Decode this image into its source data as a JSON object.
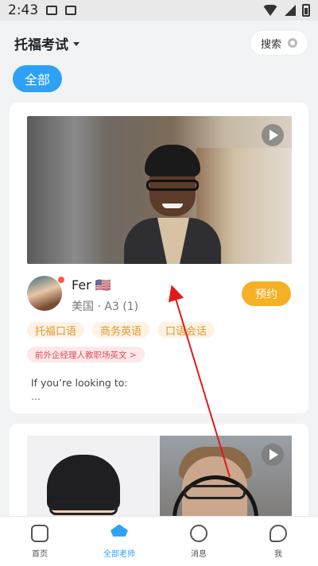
{
  "status_bar": {
    "time": "2:43"
  },
  "header": {
    "title": "托福考试",
    "search_label": "搜索"
  },
  "filter": {
    "active_chip": "全部"
  },
  "cards": [
    {
      "teacher_name": "Fer 🇺🇸",
      "meta": "美国 · A3 (1)",
      "book_label": "预约",
      "tags": [
        "托福口语",
        "商务英语",
        "口语会话"
      ],
      "highlight": "前外企经理人教职场英文 >",
      "intro_line1": "If you’re looking to:",
      "intro_line2": "..."
    }
  ],
  "bottom_nav": [
    {
      "label": "首页",
      "active": false
    },
    {
      "label": "全部老师",
      "active": true
    },
    {
      "label": "消息",
      "active": false
    },
    {
      "label": "我",
      "active": false
    }
  ],
  "colors": {
    "accent_blue": "#2ea1f7",
    "book_orange": "#f5b025",
    "annotation_red": "#e11a1a"
  }
}
